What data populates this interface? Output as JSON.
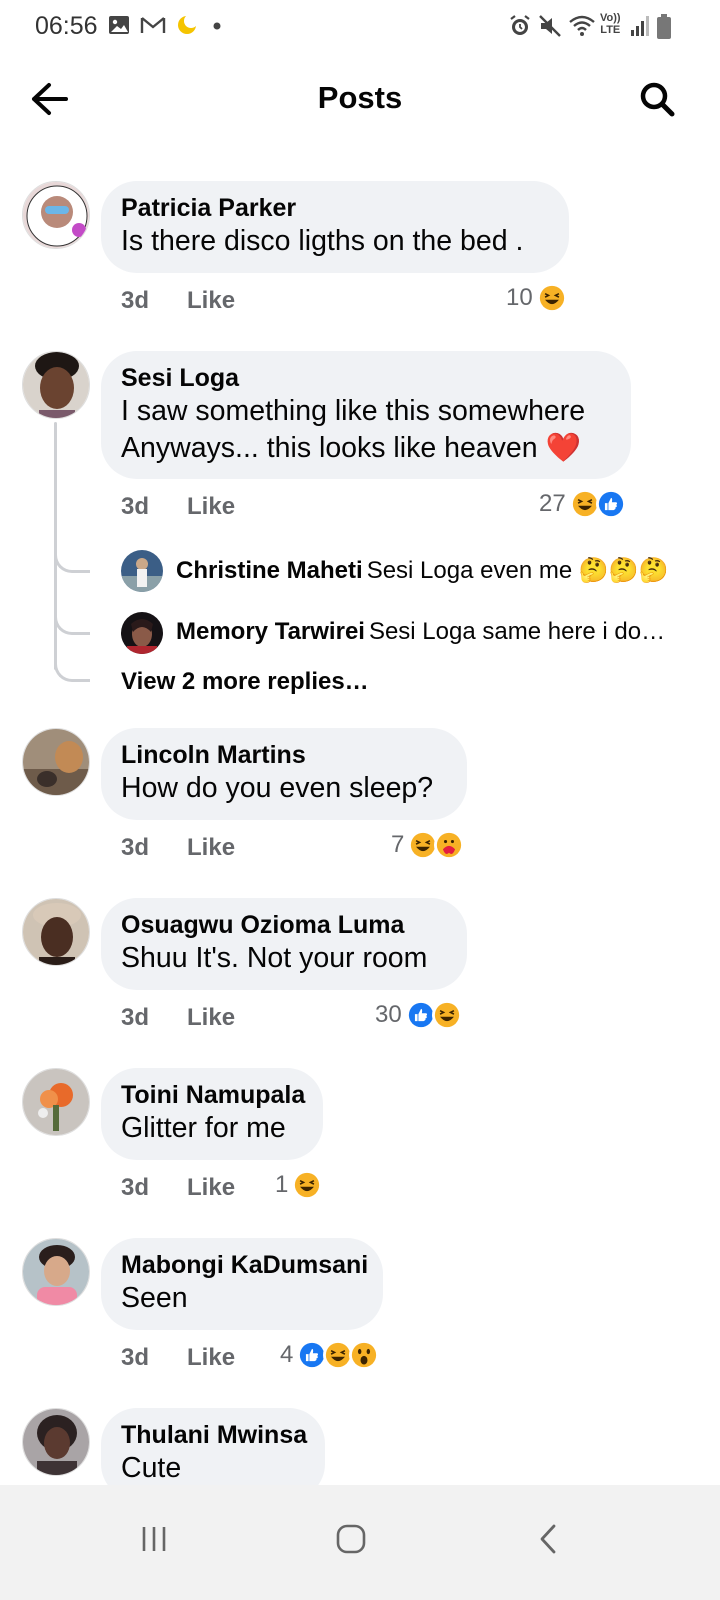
{
  "status_bar": {
    "time": "06:56",
    "left_icons": [
      "gallery-icon",
      "gmail-icon",
      "moon-icon",
      "dot-icon"
    ],
    "right_icons": [
      "alarm-icon",
      "mute-icon",
      "wifi-icon",
      "volte-icon",
      "signal-icon",
      "battery-icon"
    ],
    "volte_label": "Vo))\nLTE"
  },
  "header": {
    "title": "Posts",
    "back_icon": "arrow-left-icon",
    "search_icon": "search-icon"
  },
  "colors": {
    "bubble": "#f0f2f5",
    "meta_text": "#65676b",
    "like_blue": "#1877f2",
    "haha_yellow": "#f7b125",
    "heart_red": "#e41e3f"
  },
  "comments": [
    {
      "author": "Patricia Parker",
      "text": [
        "Is there disco ligths on the bed ."
      ],
      "time": "3d",
      "like": "Like",
      "count": "10",
      "reactions": [
        "haha"
      ]
    },
    {
      "author": "Sesi Loga",
      "text": [
        "I saw something like this somewhere",
        "Anyways... this looks like heaven ❤️"
      ],
      "time": "3d",
      "like": "Like",
      "count": "27",
      "reactions": [
        "haha",
        "like"
      ]
    },
    {
      "author": "Lincoln Martins",
      "text": [
        "How do you even sleep?"
      ],
      "time": "3d",
      "like": "Like",
      "count": "7",
      "reactions": [
        "haha",
        "care"
      ]
    },
    {
      "author": "Osuagwu Ozioma Luma",
      "text": [
        "Shuu It's. Not your room"
      ],
      "time": "3d",
      "like": "Like",
      "count": "30",
      "reactions": [
        "like",
        "haha"
      ]
    },
    {
      "author": "Toini Namupala",
      "text": [
        "Glitter for me"
      ],
      "time": "3d",
      "like": "Like",
      "count": "1",
      "reactions": [
        "haha"
      ]
    },
    {
      "author": "Mabongi KaDumsani",
      "text": [
        "Seen"
      ],
      "time": "3d",
      "like": "Like",
      "count": "4",
      "reactions": [
        "like",
        "haha",
        "wow"
      ]
    },
    {
      "author": "Thulani Mwinsa",
      "text": [
        "Cute"
      ]
    }
  ],
  "replies": [
    {
      "author": "Christine Maheti",
      "text": "Sesi Loga even me 🤔🤔🤔"
    },
    {
      "author": "Memory Tarwirei",
      "text": "Sesi Loga same here  i do…"
    }
  ],
  "view_more": "View 2 more replies…",
  "nav_bar": {
    "icons": [
      "recent-apps-icon",
      "home-icon",
      "back-icon"
    ]
  }
}
